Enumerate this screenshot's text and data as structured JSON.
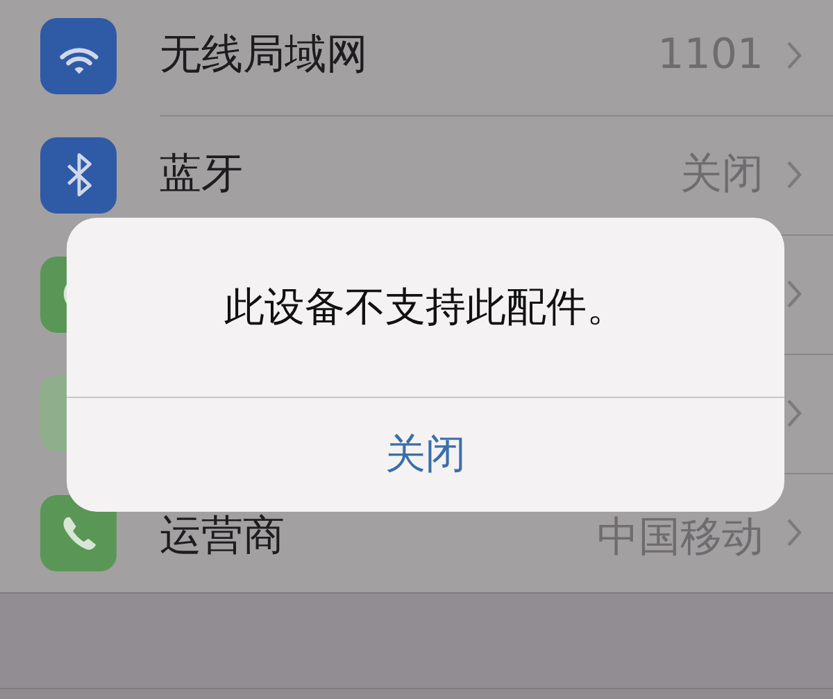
{
  "settings_rows": [
    {
      "label": "无线局域网",
      "value": "1101",
      "chevron": true
    },
    {
      "label": "蓝牙",
      "value": "关闭",
      "chevron": true
    },
    {
      "chevron": true
    },
    {
      "chevron": true
    },
    {
      "label": "运营商",
      "value": "中国移动",
      "chevron": true
    }
  ],
  "alert": {
    "message": "此设备不支持此配件。",
    "buttons": [
      "关闭"
    ]
  }
}
